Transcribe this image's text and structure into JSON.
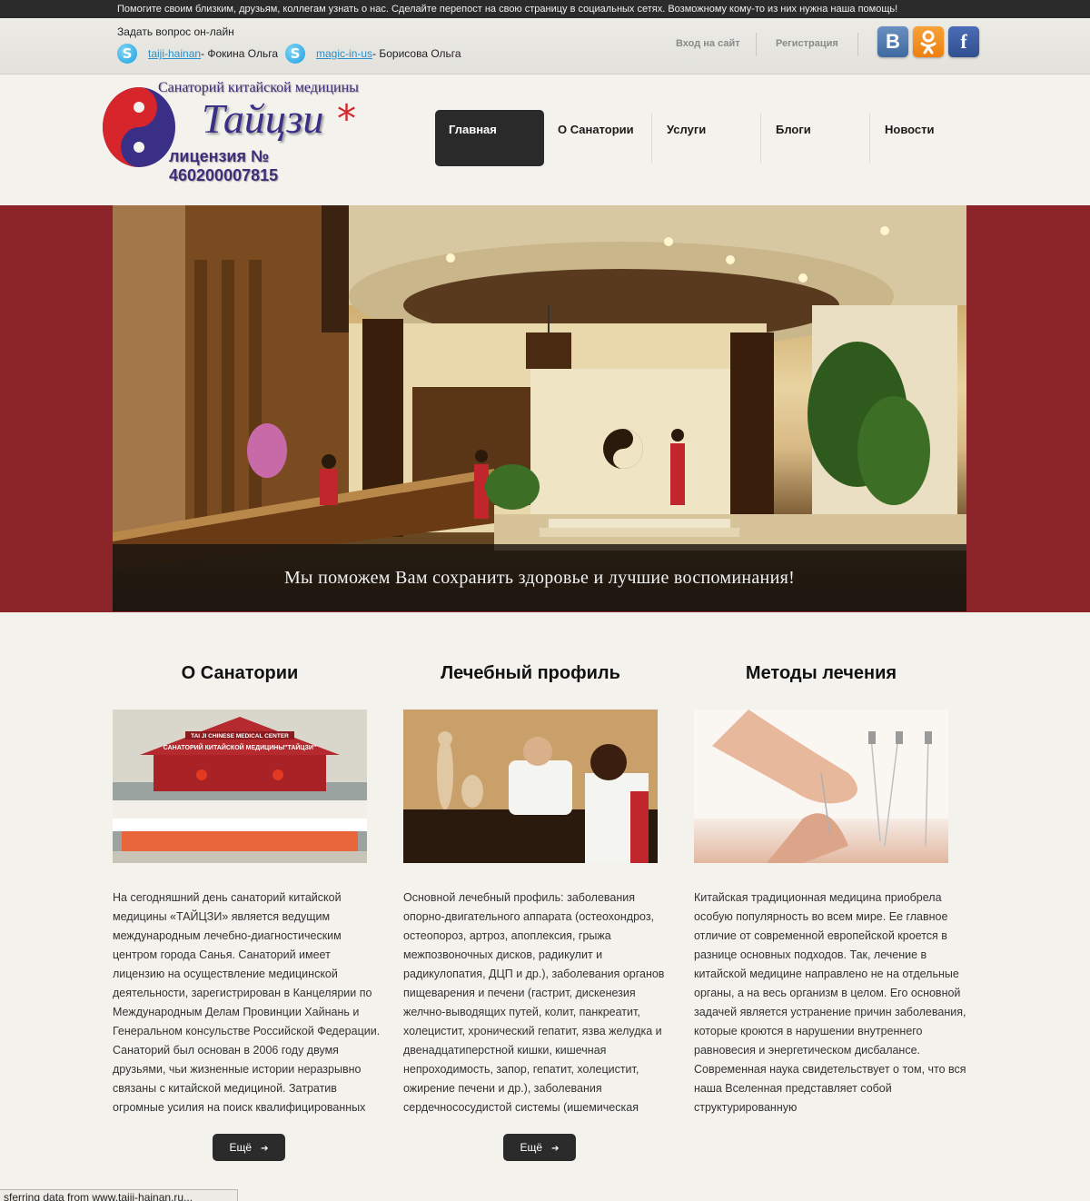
{
  "top_strip": {
    "message": "Помогите своим близким, друзьям, коллегам узнать о нас. Сделайте перепост на свою страницу в социальных сетях. Возможному кому-то из них нужна наша помощь!"
  },
  "contact": {
    "ask_label": "Задать вопрос он-лайн",
    "skype": [
      {
        "login": "taiji-hainan",
        "person": " - Фокина Ольга"
      },
      {
        "login": "magic-in-us",
        "person": " - Борисова Ольга"
      }
    ],
    "skype_icon_letter": "S"
  },
  "auth": {
    "login_label": "Вход на сайт",
    "register_label": "Регистрация"
  },
  "social": {
    "vk_label": "B",
    "ok_label": "ok",
    "fb_label": "f"
  },
  "logo": {
    "title": "Санаторий китайской медицины",
    "name": "Тайцзи",
    "star": "*",
    "license": "лицензия № 460200007815"
  },
  "nav": [
    {
      "label": "Главная",
      "active": true
    },
    {
      "label": "О Санатории",
      "active": false
    },
    {
      "label": "Услуги",
      "active": false
    },
    {
      "label": "Блоги",
      "active": false
    },
    {
      "label": "Новости",
      "active": false
    }
  ],
  "hero": {
    "caption": "Мы поможем Вам сохранить здоровье и лучшие воспоминания!"
  },
  "columns": [
    {
      "title": "О Санатории",
      "image_banner_top": "TAI JI CHINESE MEDICAL CENTER",
      "image_banner": "САНАТОРИЙ КИТАЙСКОЙ МЕДИЦИНЫ\"ТАЙЦЗИ\"",
      "text": "На сегодняшний день санаторий китайской медицины «ТАЙЦЗИ» является ведущим международным лечебно-диагностическим центром города Санья. Санаторий имеет лицензию на осуществление медицинской деятельности, зарегистрирован в Канцелярии по Международным Делам Провинции Хайнань и Генеральном консульстве Российской Федерации. Санаторий был основан в 2006 году двумя друзьями, чьи жизненные истории неразрывно связаны с китайской медициной. Затратив огромные усилия на поиск квалифицированных",
      "button": "Ещё"
    },
    {
      "title": "Лечебный профиль",
      "text": "Основной лечебный профиль: заболевания опорно-двигательного аппарата (остеохондроз, остеопороз, артроз, апоплексия, грыжа межпозвоночных дисков, радикулит и радикулопатия, ДЦП и др.), заболевания органов пищеварения и печени (гастрит, дискенезия желчно-выводящих путей, колит, панкреатит, холецистит, хронический гепатит, язва желудка и двенадцатиперстной кишки, кишечная непроходимость, запор, гепатит, холецистит, ожирение печени и др.), заболевания сердечнососудистой системы (ишемическая",
      "button": "Ещё"
    },
    {
      "title": "Методы лечения",
      "text": "Китайская традиционная медицина приобрела особую популярность во всем мире. Ее главное отличие от современной европейской кроется в разнице основных подходов. Так, лечение в китайской медицине направлено не на отдельные органы, а на весь организм в целом. Его основной задачей является устранение причин заболевания, которые кроются в нарушении внутреннего равновесия и энергетическом дисбалансе. Современная наука свидетельствует о том, что вся наша Вселенная представляет собой структурированную"
    }
  ],
  "status_bar": {
    "text": "sferring data from www.taiji-hainan.ru..."
  },
  "colors": {
    "hero_band": "#8b252a",
    "dark": "#2b2b2b",
    "link": "#2a8fc9",
    "logo_blue": "#3a2f86",
    "logo_red": "#d7262b"
  }
}
